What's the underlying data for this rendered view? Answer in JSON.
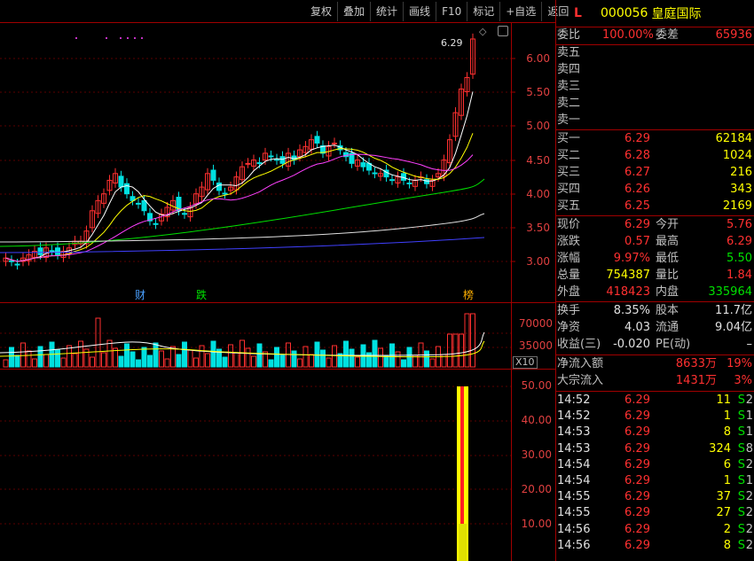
{
  "toolbar": [
    "复权",
    "叠加",
    "统计",
    "画线",
    "F10",
    "标记",
    "+自选",
    "返回"
  ],
  "stock": {
    "flag": "L",
    "code": "000056",
    "name": "皇庭国际"
  },
  "price_axis": [
    "6.00",
    "5.50",
    "5.00",
    "4.50",
    "4.00",
    "3.50",
    "3.00"
  ],
  "max_label": "6.29",
  "vol_axis": [
    "70000",
    "35000"
  ],
  "vol_unit": "X10",
  "ind_axis": [
    "50.00",
    "40.00",
    "30.00",
    "20.00",
    "10.00"
  ],
  "events": [
    {
      "text": "财",
      "color": "#4aa0ff"
    },
    {
      "text": "跌",
      "color": "#00e000"
    },
    {
      "text": "榜",
      "color": "#ffb000"
    }
  ],
  "order_book": {
    "weibi_label": "委比",
    "weibi": "100.00%",
    "weicha_label": "委差",
    "weicha": "65936",
    "sells": [
      "卖五",
      "卖四",
      "卖三",
      "卖二",
      "卖一"
    ],
    "buys": [
      {
        "label": "买一",
        "price": "6.29",
        "vol": "62184"
      },
      {
        "label": "买二",
        "price": "6.28",
        "vol": "1024"
      },
      {
        "label": "买三",
        "price": "6.27",
        "vol": "216"
      },
      {
        "label": "买四",
        "price": "6.26",
        "vol": "343"
      },
      {
        "label": "买五",
        "price": "6.25",
        "vol": "2169"
      }
    ]
  },
  "quote": [
    {
      "l1": "现价",
      "v1": "6.29",
      "c1": "red",
      "l2": "今开",
      "v2": "5.76",
      "c2": "red"
    },
    {
      "l1": "涨跌",
      "v1": "0.57",
      "c1": "red",
      "l2": "最高",
      "v2": "6.29",
      "c2": "red"
    },
    {
      "l1": "涨幅",
      "v1": "9.97%",
      "c1": "red",
      "l2": "最低",
      "v2": "5.50",
      "c2": "green"
    },
    {
      "l1": "总量",
      "v1": "754387",
      "c1": "yellow",
      "l2": "量比",
      "v2": "1.84",
      "c2": "red"
    },
    {
      "l1": "外盘",
      "v1": "418423",
      "c1": "red",
      "l2": "内盘",
      "v2": "335964",
      "c2": "green"
    }
  ],
  "stats": [
    {
      "l1": "换手",
      "v1": "8.35%",
      "l2": "股本",
      "v2": "11.7亿"
    },
    {
      "l1": "净资",
      "v1": "4.03",
      "l2": "流通",
      "v2": "9.04亿"
    },
    {
      "l1": "收益(三)",
      "v1": "-0.020",
      "l2": "PE(动)",
      "v2": "–"
    }
  ],
  "flows": [
    {
      "label": "净流入额",
      "value": "8633万",
      "pct": "19%"
    },
    {
      "label": "大宗流入",
      "value": "1431万",
      "pct": "3%"
    }
  ],
  "ticks": [
    {
      "time": "14:52",
      "price": "6.29",
      "vol": "11",
      "bs": "S",
      "n": "2"
    },
    {
      "time": "14:52",
      "price": "6.29",
      "vol": "1",
      "bs": "S",
      "n": "1"
    },
    {
      "time": "14:53",
      "price": "6.29",
      "vol": "8",
      "bs": "S",
      "n": "1"
    },
    {
      "time": "14:53",
      "price": "6.29",
      "vol": "324",
      "bs": "S",
      "n": "8"
    },
    {
      "time": "14:54",
      "price": "6.29",
      "vol": "6",
      "bs": "S",
      "n": "2"
    },
    {
      "time": "14:54",
      "price": "6.29",
      "vol": "1",
      "bs": "S",
      "n": "1"
    },
    {
      "time": "14:55",
      "price": "6.29",
      "vol": "37",
      "bs": "S",
      "n": "2"
    },
    {
      "time": "14:55",
      "price": "6.29",
      "vol": "27",
      "bs": "S",
      "n": "2"
    },
    {
      "time": "14:56",
      "price": "6.29",
      "vol": "2",
      "bs": "S",
      "n": "2"
    },
    {
      "time": "14:56",
      "price": "6.29",
      "vol": "8",
      "bs": "S",
      "n": "2"
    }
  ],
  "colors": {
    "up": "#ff3030",
    "down": "#00e0e0",
    "ma5": "#ffffff",
    "ma10": "#ffff00",
    "ma20": "#ff40ff",
    "ma60": "#00e000",
    "ma120": "#e0e0e0",
    "ma250": "#4040ff"
  }
}
